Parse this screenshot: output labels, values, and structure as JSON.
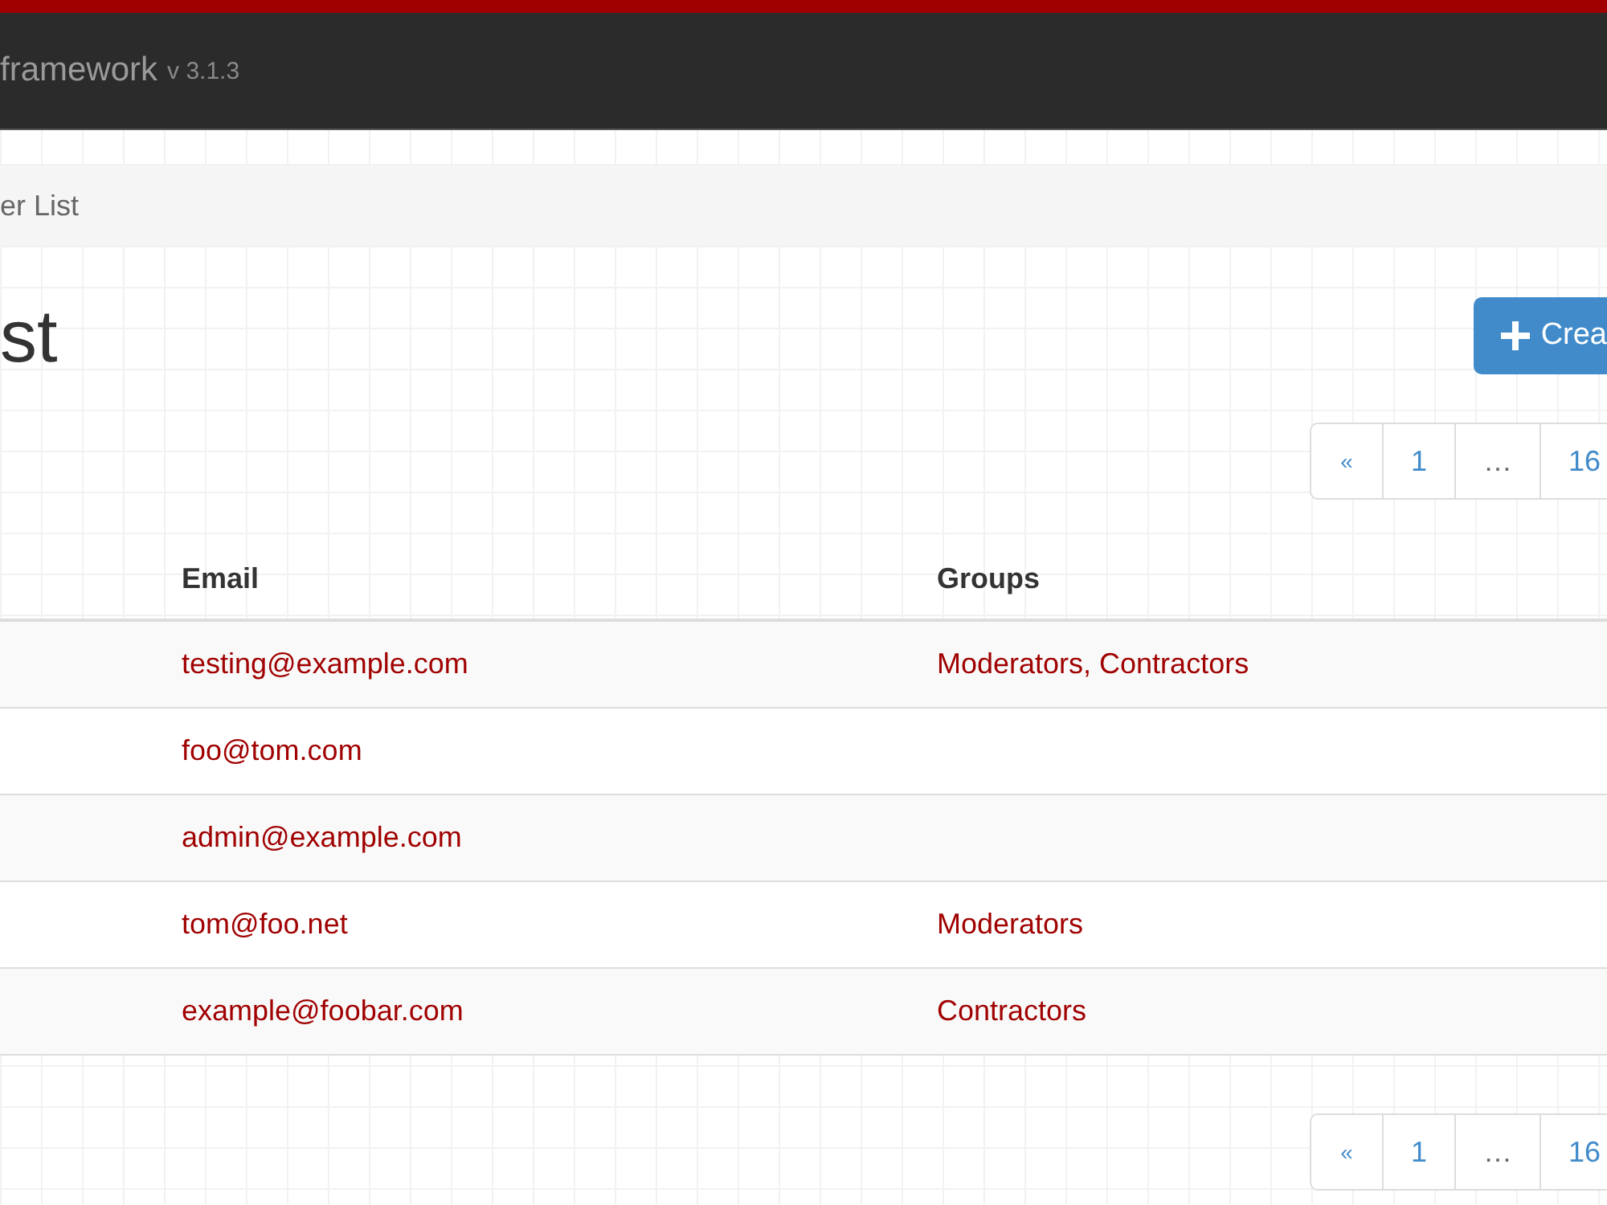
{
  "navbar": {
    "brand": "framework",
    "version": "v 3.1.3"
  },
  "breadcrumb": "er List",
  "heading": "st",
  "create_button": "Crea",
  "pagination_top": [
    {
      "label": "«"
    },
    {
      "label": "1"
    },
    {
      "label": "…"
    },
    {
      "label": "16"
    }
  ],
  "table": {
    "columns": [
      "Email",
      "Groups"
    ],
    "rows": [
      {
        "email": "testing@example.com",
        "groups": "Moderators, Contractors"
      },
      {
        "email": "foo@tom.com",
        "groups": ""
      },
      {
        "email": "admin@example.com",
        "groups": ""
      },
      {
        "email": "tom@foo.net",
        "groups": "Moderators"
      },
      {
        "email": "example@foobar.com",
        "groups": "Contractors"
      }
    ]
  },
  "pagination_bottom": [
    {
      "label": "«"
    },
    {
      "label": "1"
    },
    {
      "label": "…"
    },
    {
      "label": "16"
    }
  ]
}
